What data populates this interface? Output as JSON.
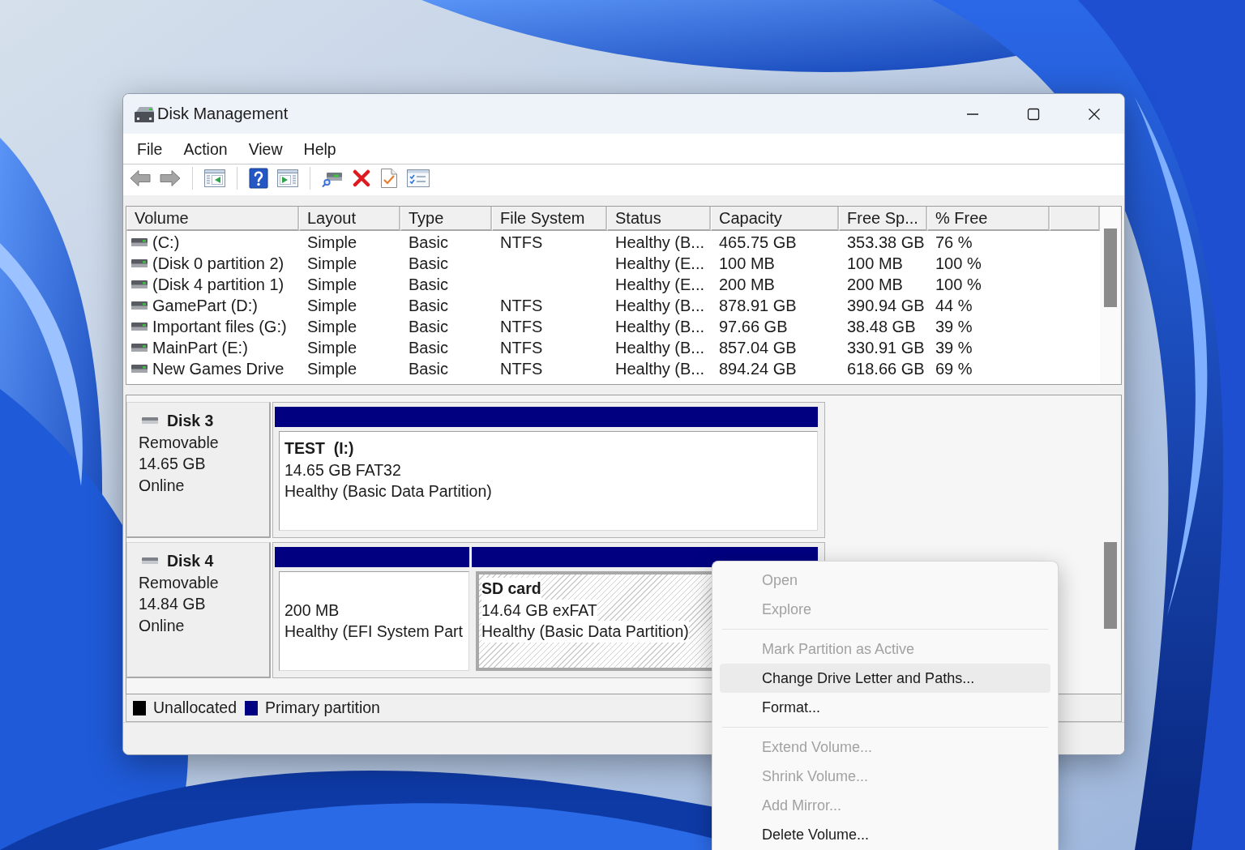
{
  "window": {
    "title": "Disk Management"
  },
  "menu_bar": [
    "File",
    "Action",
    "View",
    "Help"
  ],
  "volume_table": {
    "columns": [
      "Volume",
      "Layout",
      "Type",
      "File System",
      "Status",
      "Capacity",
      "Free Sp...",
      "% Free"
    ],
    "rows": [
      {
        "volume": "(C:)",
        "layout": "Simple",
        "type": "Basic",
        "file_system": "NTFS",
        "status": "Healthy (B...",
        "capacity": "465.75 GB",
        "column_7": "353.38 GB",
        "percent_free": "76 %"
      },
      {
        "volume": "(Disk 0 partition 2)",
        "layout": "Simple",
        "type": "Basic",
        "status": "Healthy (E...",
        "capacity": "100 MB",
        "column_7": "100 MB",
        "percent_free": "100 %"
      },
      {
        "volume": "(Disk 4 partition 1)",
        "layout": "Simple",
        "type": "Basic",
        "status": "Healthy (E...",
        "capacity": "200 MB",
        "column_7": "200 MB",
        "percent_free": "100 %"
      },
      {
        "volume": "GamePart (D:)",
        "layout": "Simple",
        "type": "Basic",
        "file_system": "NTFS",
        "status": "Healthy (B...",
        "capacity": "878.91 GB",
        "column_7": "390.94 GB",
        "percent_free": "44 %"
      },
      {
        "volume": "Important files (G:)",
        "layout": "Simple",
        "type": "Basic",
        "file_system": "NTFS",
        "status": "Healthy (B...",
        "capacity": "97.66 GB",
        "column_7": "38.48 GB",
        "percent_free": "39 %"
      },
      {
        "volume": "MainPart (E:)",
        "layout": "Simple",
        "type": "Basic",
        "file_system": "NTFS",
        "status": "Healthy (B...",
        "capacity": "857.04 GB",
        "column_7": "330.91 GB",
        "percent_free": "39 %"
      },
      {
        "volume": "New Games Drive",
        "layout": "Simple",
        "type": "Basic",
        "file_system": "NTFS",
        "status": "Healthy (B...",
        "capacity": "894.24 GB",
        "column_7": "618.66 GB",
        "percent_free": "69 %"
      }
    ]
  },
  "disks": [
    {
      "name": "Disk 3",
      "type": "Removable",
      "size": "14.65 GB",
      "status": "Online",
      "partitions": [
        {
          "kind": "primary",
          "name": "TEST  (I:)",
          "size_fs": "14.65 GB FAT32",
          "status": "Healthy (Basic Data Partition)",
          "selected": false
        }
      ]
    },
    {
      "name": "Disk 4",
      "type": "Removable",
      "size": "14.84 GB",
      "status": "Online",
      "partitions": [
        {
          "kind": "primary",
          "size_fs": "200 MB",
          "status": "Healthy (EFI System Part",
          "selected": false
        },
        {
          "kind": "primary",
          "name": "SD card",
          "size_fs": "14.64 GB exFAT",
          "status": "Healthy (Basic Data Partition)",
          "selected": true
        }
      ]
    }
  ],
  "legend": [
    {
      "kind": "unallocated",
      "label": "Unallocated",
      "color": "#000000"
    },
    {
      "kind": "primary",
      "label": "Primary partition",
      "color": "#000080"
    }
  ],
  "context_menu": {
    "groups": [
      {
        "items": [
          {
            "label": "Open",
            "disabled": true,
            "highlighted": false
          },
          {
            "label": "Explore",
            "disabled": true,
            "highlighted": false
          }
        ]
      },
      {
        "items": [
          {
            "label": "Mark Partition as Active",
            "disabled": true,
            "highlighted": false
          },
          {
            "label": "Change Drive Letter and Paths...",
            "disabled": false,
            "highlighted": true
          },
          {
            "label": "Format...",
            "disabled": false,
            "highlighted": false
          }
        ]
      },
      {
        "items": [
          {
            "label": "Extend Volume...",
            "disabled": true,
            "highlighted": false
          },
          {
            "label": "Shrink Volume...",
            "disabled": true,
            "highlighted": false
          },
          {
            "label": "Add Mirror...",
            "disabled": true,
            "highlighted": false
          },
          {
            "label": "Delete Volume...",
            "disabled": false,
            "highlighted": false
          }
        ]
      }
    ]
  }
}
